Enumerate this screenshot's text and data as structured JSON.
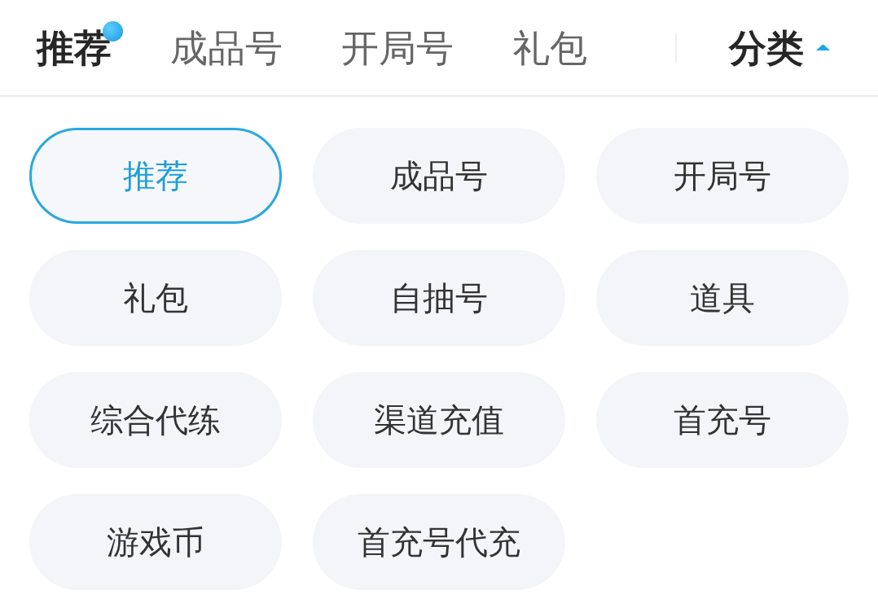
{
  "tabs": [
    {
      "label": "推荐",
      "selected": true,
      "dot": true
    },
    {
      "label": "成品号",
      "selected": false,
      "dot": false
    },
    {
      "label": "开局号",
      "selected": false,
      "dot": false
    },
    {
      "label": "礼包",
      "selected": false,
      "dot": false
    }
  ],
  "category_toggle": {
    "label": "分类",
    "expanded": true
  },
  "categories": [
    {
      "label": "推荐",
      "selected": true
    },
    {
      "label": "成品号",
      "selected": false
    },
    {
      "label": "开局号",
      "selected": false
    },
    {
      "label": "礼包",
      "selected": false
    },
    {
      "label": "自抽号",
      "selected": false
    },
    {
      "label": "道具",
      "selected": false
    },
    {
      "label": "综合代练",
      "selected": false
    },
    {
      "label": "渠道充值",
      "selected": false
    },
    {
      "label": "首充号",
      "selected": false
    },
    {
      "label": "游戏币",
      "selected": false
    },
    {
      "label": "首充号代充",
      "selected": false
    }
  ]
}
